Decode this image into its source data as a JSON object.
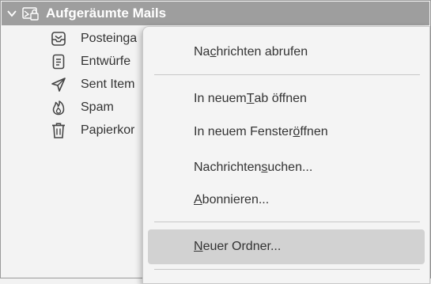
{
  "account": {
    "name": "Aufgeräumte Mails",
    "chevron_icon": "chevron-down-icon",
    "icon": "mail-account-icon"
  },
  "folders": [
    {
      "label": "Posteinga",
      "icon": "inbox-icon"
    },
    {
      "label": "Entwürfe",
      "icon": "drafts-icon"
    },
    {
      "label": "Sent Item",
      "icon": "sent-icon"
    },
    {
      "label": "Spam",
      "icon": "spam-flame-icon"
    },
    {
      "label": "Papierkor",
      "icon": "trash-icon"
    }
  ],
  "menu": {
    "items": [
      {
        "pre": "Na",
        "key": "c",
        "post": "hrichten abrufen"
      },
      {
        "pre": "In neuem ",
        "key": "T",
        "post": "ab öffnen"
      },
      {
        "pre": "In neuem Fenster ",
        "key": "ö",
        "post": "ffnen"
      },
      {
        "pre": "Nachrichten ",
        "key": "s",
        "post": "uchen..."
      },
      {
        "pre": "",
        "key": "A",
        "post": "bonnieren..."
      },
      {
        "pre": "",
        "key": "N",
        "post": "euer Ordner..."
      }
    ]
  },
  "colors": {
    "account_bg": "#9e9e9e",
    "highlight": "#d2d2d2"
  }
}
